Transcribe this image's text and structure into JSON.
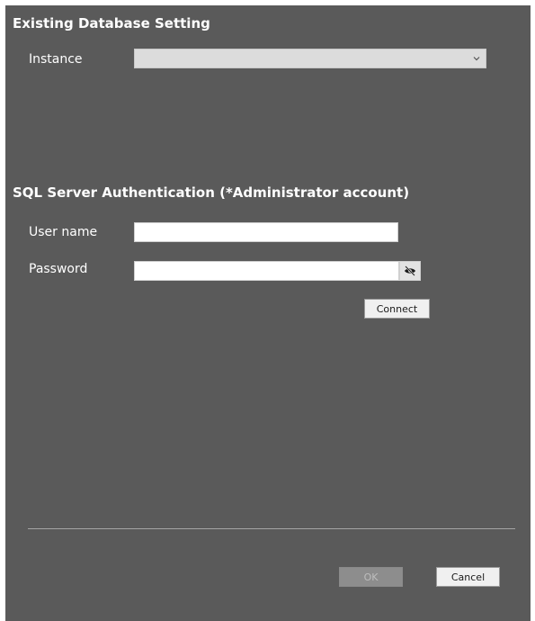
{
  "existing_db": {
    "title": "Existing Database Setting",
    "instance_label": "Instance",
    "instance_value": "",
    "dropdown_icon": "chevron-down-icon"
  },
  "sql_auth": {
    "title": "SQL Server Authentication (*Administrator account)",
    "username_label": "User name",
    "username_value": "",
    "password_label": "Password",
    "password_value": "",
    "show_password_icon": "eye-slash-icon",
    "connect_label": "Connect"
  },
  "footer": {
    "ok_label": "OK",
    "cancel_label": "Cancel"
  },
  "colors": {
    "background": "#5a5a5a",
    "text": "#ffffff",
    "divider": "#a5a5a5"
  }
}
